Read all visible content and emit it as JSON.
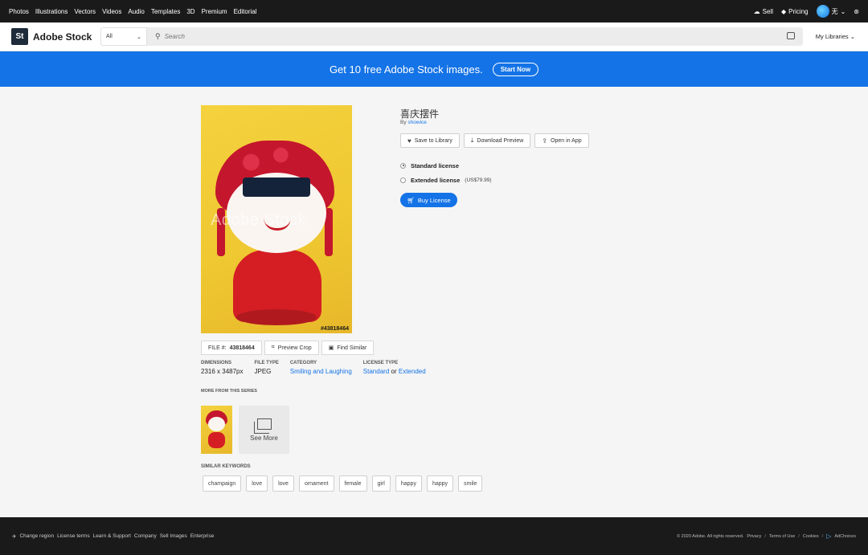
{
  "topnav": {
    "links": [
      "Photos",
      "Illustrations",
      "Vectors",
      "Videos",
      "Audio",
      "Templates",
      "3D",
      "Premium",
      "Editorial"
    ],
    "sell": "Sell",
    "pricing": "Pricing",
    "user_name": "无"
  },
  "header": {
    "logo_mark": "St",
    "logo_text": "Adobe Stock",
    "category": "All",
    "search_placeholder": "Search",
    "my_libraries": "My Libraries"
  },
  "banner": {
    "message": "Get 10 free Adobe Stock images.",
    "button": "Start Now"
  },
  "asset": {
    "watermark": "Adobe Stock",
    "image_id": "#43818464",
    "title": "喜庆摆件",
    "by_prefix": "By",
    "author": "showice",
    "actions": {
      "save": "Save to Library",
      "download": "Download Preview",
      "open": "Open in App"
    },
    "licenses": {
      "standard": "Standard license",
      "extended": "Extended license",
      "extended_price": "(US$79.99)"
    },
    "buy": "Buy License"
  },
  "file": {
    "label": "FILE #:",
    "number": "43818464",
    "preview_crop": "Preview Crop",
    "find_similar": "Find Similar"
  },
  "meta": {
    "dimensions_label": "DIMENSIONS",
    "dimensions": "2316 x 3487px",
    "filetype_label": "FILE TYPE",
    "filetype": "JPEG",
    "category_label": "CATEGORY",
    "category": "Smiling and Laughing",
    "licensetype_label": "LICENSE TYPE",
    "license_standard": "Standard",
    "license_or": "or",
    "license_extended": "Extended"
  },
  "series": {
    "label": "MORE FROM THIS SERIES",
    "see_more": "See More"
  },
  "keywords": {
    "label": "SIMILAR KEYWORDS",
    "items": [
      "champaign",
      "love",
      "love",
      "ornament",
      "female",
      "girl",
      "happy",
      "happy",
      "smile"
    ]
  },
  "footer": {
    "change_region": "Change region",
    "license_terms": "License terms",
    "learn_support": "Learn & Support",
    "company": "Company",
    "sell_images": "Sell Images",
    "enterprise": "Enterprise",
    "copyright": "© 2020 Adobe. All rights reserved.",
    "privacy": "Privacy",
    "terms": "Terms of Use",
    "cookies": "Cookies",
    "adchoices": "AdChoices"
  }
}
